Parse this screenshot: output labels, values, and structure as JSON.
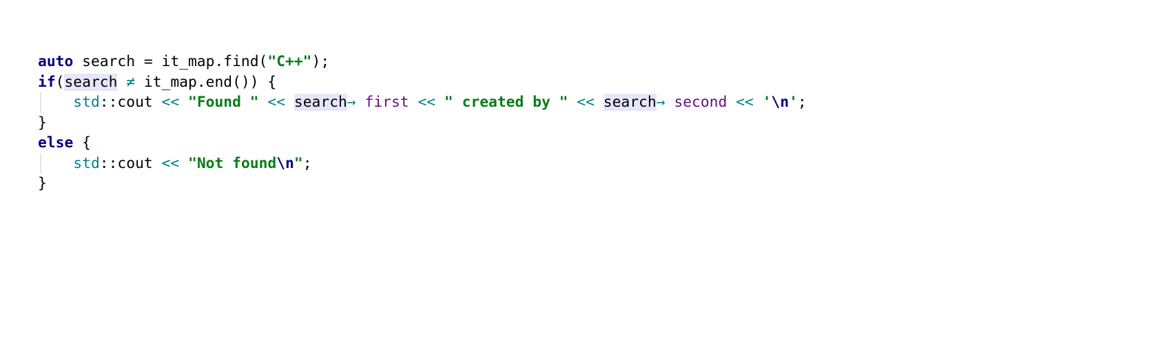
{
  "editor": {
    "language": "C++",
    "lines": [
      {
        "indent": false,
        "tokens": [
          {
            "text": "auto",
            "type": "kw"
          },
          {
            "text": " search = it_map.find(",
            "type": "ident"
          },
          {
            "text": "\"C++\"",
            "type": "str"
          },
          {
            "text": ");",
            "type": "ident"
          }
        ]
      },
      {
        "indent": false,
        "tokens": [
          {
            "text": "if",
            "type": "kw"
          },
          {
            "text": "(",
            "type": "ident"
          },
          {
            "text": "search",
            "type": "ident",
            "highlight": true
          },
          {
            "text": " ",
            "type": "ident"
          },
          {
            "text": "≠",
            "type": "op"
          },
          {
            "text": " it_map.end()) {",
            "type": "ident"
          }
        ]
      },
      {
        "indent": true,
        "tokens": [
          {
            "text": "    ",
            "type": "ident"
          },
          {
            "text": "std",
            "type": "ns"
          },
          {
            "text": "::",
            "type": "ident"
          },
          {
            "text": "cout ",
            "type": "ident"
          },
          {
            "text": "<<",
            "type": "op"
          },
          {
            "text": " ",
            "type": "ident"
          },
          {
            "text": "\"Found \"",
            "type": "str"
          },
          {
            "text": " ",
            "type": "ident"
          },
          {
            "text": "<<",
            "type": "op"
          },
          {
            "text": " ",
            "type": "ident"
          },
          {
            "text": "search",
            "type": "ident",
            "highlight": true
          },
          {
            "text": "→ ",
            "type": "op"
          },
          {
            "text": "first",
            "type": "field"
          },
          {
            "text": " ",
            "type": "ident"
          },
          {
            "text": "<<",
            "type": "op"
          },
          {
            "text": " ",
            "type": "ident"
          },
          {
            "text": "\" created by \"",
            "type": "str"
          },
          {
            "text": " ",
            "type": "ident"
          },
          {
            "text": "<<",
            "type": "op"
          },
          {
            "text": " ",
            "type": "ident"
          },
          {
            "text": "search",
            "type": "ident",
            "highlight": true
          },
          {
            "text": "→ ",
            "type": "op"
          },
          {
            "text": "second",
            "type": "field"
          },
          {
            "text": " ",
            "type": "ident"
          },
          {
            "text": "<<",
            "type": "op"
          },
          {
            "text": " ",
            "type": "ident"
          },
          {
            "text": "'",
            "type": "str"
          },
          {
            "text": "\\n",
            "type": "esc"
          },
          {
            "text": "'",
            "type": "str"
          },
          {
            "text": ";",
            "type": "ident"
          }
        ]
      },
      {
        "indent": false,
        "tokens": [
          {
            "text": "}",
            "type": "ident"
          }
        ]
      },
      {
        "indent": false,
        "tokens": [
          {
            "text": "else",
            "type": "kw"
          },
          {
            "text": " {",
            "type": "ident"
          }
        ]
      },
      {
        "indent": true,
        "tokens": [
          {
            "text": "    ",
            "type": "ident"
          },
          {
            "text": "std",
            "type": "ns"
          },
          {
            "text": "::",
            "type": "ident"
          },
          {
            "text": "cout ",
            "type": "ident"
          },
          {
            "text": "<<",
            "type": "op"
          },
          {
            "text": " ",
            "type": "ident"
          },
          {
            "text": "\"Not found",
            "type": "str"
          },
          {
            "text": "\\n",
            "type": "esc"
          },
          {
            "text": "\"",
            "type": "str"
          },
          {
            "text": ";",
            "type": "ident"
          }
        ]
      },
      {
        "indent": false,
        "tokens": [
          {
            "text": "}",
            "type": "ident"
          }
        ]
      }
    ],
    "colors": {
      "keyword": "#000080",
      "string": "#067d17",
      "escape": "#000080",
      "namespace": "#00808a",
      "operator": "#00808a",
      "field": "#660e7a",
      "identifier": "#000000",
      "usage_highlight": "#e6e6fa",
      "indent_guide": "#e4e4e4"
    }
  }
}
